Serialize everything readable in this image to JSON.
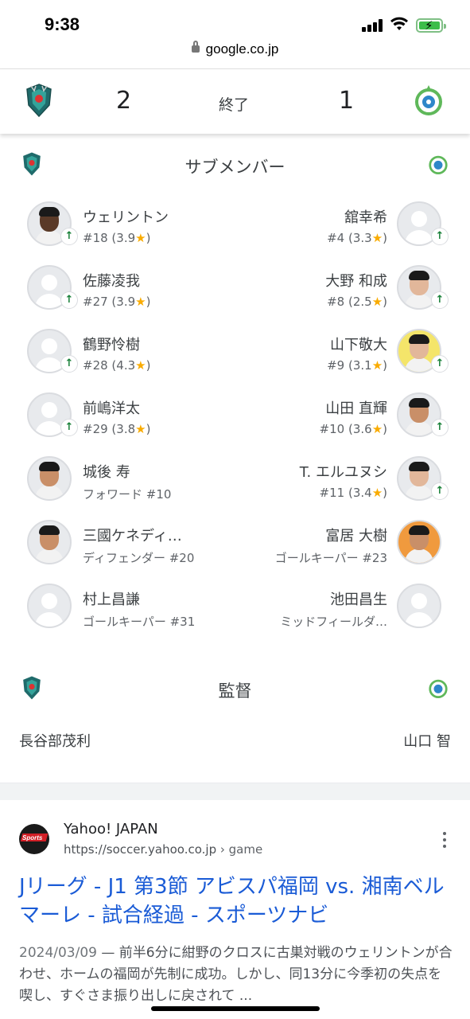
{
  "status_bar": {
    "time": "9:38"
  },
  "browser": {
    "url": "google.co.jp"
  },
  "match": {
    "home_score": "2",
    "away_score": "1",
    "status": "終了"
  },
  "subs": {
    "title": "サブメンバー",
    "home": [
      {
        "name": "ウェリントン",
        "meta": "#18 (3.9",
        "sub_in": true
      },
      {
        "name": "佐藤凌我",
        "meta": "#27 (3.9",
        "sub_in": true
      },
      {
        "name": "鶴野怜樹",
        "meta": "#28 (4.3",
        "sub_in": true
      },
      {
        "name": "前嶋洋太",
        "meta": "#29 (3.8",
        "sub_in": true
      },
      {
        "name": "城後 寿",
        "meta": "フォワード #10",
        "sub_in": false
      },
      {
        "name": "三國ケネディ…",
        "meta": "ディフェンダー #20",
        "sub_in": false
      },
      {
        "name": "村上昌謙",
        "meta": "ゴールキーパー #31",
        "sub_in": false
      }
    ],
    "away": [
      {
        "name": "舘幸希",
        "meta": "#4 (3.3",
        "sub_in": true
      },
      {
        "name": "大野 和成",
        "meta": "#8 (2.5",
        "sub_in": true
      },
      {
        "name": "山下敬大",
        "meta": "#9 (3.1",
        "sub_in": true
      },
      {
        "name": "山田 直輝",
        "meta": "#10 (3.6",
        "sub_in": true
      },
      {
        "name": "T. エルユヌシ",
        "meta": "#11 (3.4",
        "sub_in": true
      },
      {
        "name": "富居 大樹",
        "meta": "ゴールキーパー #23",
        "sub_in": false
      },
      {
        "name": "池田昌生",
        "meta": "ミッドフィールダ…",
        "sub_in": false
      }
    ],
    "rating_suffix": "★)",
    "sub_in_icon": "↑"
  },
  "manager": {
    "title": "監督",
    "home": "長谷部茂利",
    "away": "山口 智"
  },
  "result": {
    "site_name": "Yahoo! JAPAN",
    "url": "https://soccer.yahoo.co.jp",
    "crumb": " › game",
    "favicon_text": "Sports",
    "title": "Jリーグ - J1 第3節 アビスパ福岡 vs. 湘南ベルマーレ - 試合経過 - スポーツナビ",
    "date": "2024/03/09",
    "dash": " — ",
    "snippet": "前半6分に紺野のクロスに古巣対戦のウェリントンが合わせ、ホームの福岡が先制に成功。しかし、同13分に今季初の失点を喫し、すぐさま振り出しに戻されて ..."
  },
  "colors": {
    "link": "#1a5bd6",
    "sub_in": "#188038",
    "star": "#f9ab00",
    "home_crest": "#1f6b6b",
    "away_crest": "#5fb85a"
  }
}
